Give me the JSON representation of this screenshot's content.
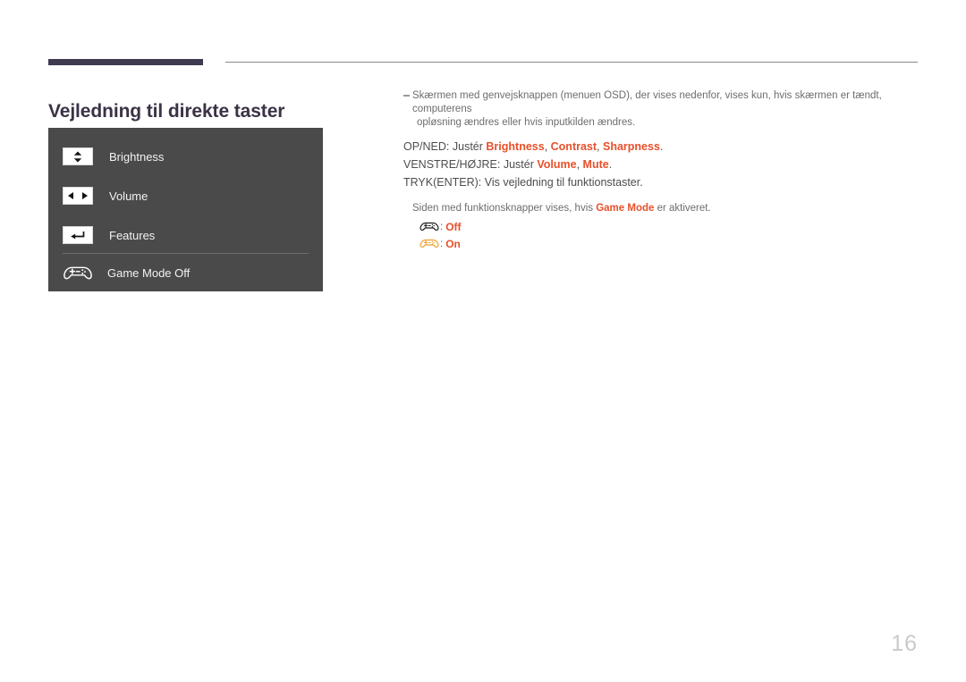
{
  "page": {
    "title": "Vejledning til direkte taster",
    "number": "16",
    "accent_color": "#e8502a",
    "heading_color": "#3b3245",
    "panel_color": "#4b4a4a",
    "rule_color": "#3f3a50"
  },
  "osd_panel": {
    "rows": [
      {
        "icon": "up-down-arrows-icon",
        "label": "Brightness"
      },
      {
        "icon": "left-right-arrows-icon",
        "label": "Volume"
      },
      {
        "icon": "enter-return-arrow-icon",
        "label": "Features"
      },
      {
        "icon": "gamepad-icon",
        "label": "Game Mode Off"
      }
    ]
  },
  "notes": {
    "osd_note_line1": "Skærmen med genvejsknappen (menuen OSD), der vises nedenfor, vises kun, hvis skærmen er tændt, computerens",
    "osd_note_line2": "opløsning ændres eller hvis inputkilden ændres.",
    "game_mode_note_prefix": "Siden med funktionsknapper vises, hvis ",
    "game_mode_note_bold": "Game Mode",
    "game_mode_note_suffix": " er aktiveret."
  },
  "instructions": [
    {
      "prefix": "OP/NED: Justér ",
      "parts": [
        "Brightness",
        "Contrast",
        "Sharpness"
      ],
      "separator": ", ",
      "suffix": "."
    },
    {
      "prefix": "VENSTRE/HØJRE: Justér ",
      "parts": [
        "Volume",
        "Mute"
      ],
      "separator": ", ",
      "suffix": "."
    }
  ],
  "enter_line": "TRYK(ENTER): Vis vejledning til funktionstaster.",
  "game_mode_states": [
    {
      "icon": "gamepad-outline-dark-icon",
      "separator": ":",
      "label": "Off",
      "color": "#1b1b1b"
    },
    {
      "icon": "gamepad-outline-orange-icon",
      "separator": ":",
      "label": "On",
      "color": "#f0a030"
    }
  ]
}
